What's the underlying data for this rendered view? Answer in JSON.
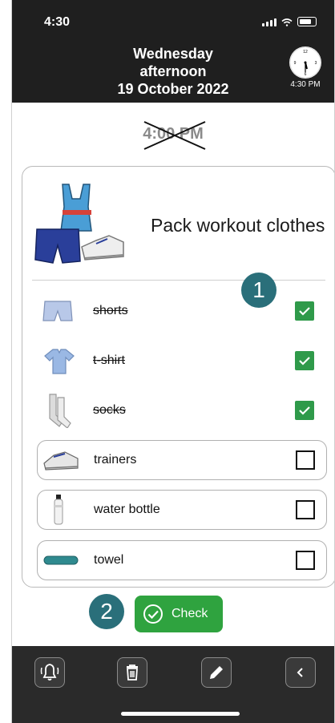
{
  "status": {
    "time": "4:30"
  },
  "header": {
    "line1": "Wednesday",
    "line2": "afternoon",
    "line3": "19 October 2022",
    "clock_label": "4:30 PM"
  },
  "schedule": {
    "time": "4:00 PM"
  },
  "task": {
    "title": "Pack workout clothes",
    "items": [
      {
        "label": "shorts",
        "checked": true
      },
      {
        "label": "t-shirt",
        "checked": true
      },
      {
        "label": "socks",
        "checked": true
      },
      {
        "label": "trainers",
        "checked": false
      },
      {
        "label": "water bottle",
        "checked": false
      },
      {
        "label": "towel",
        "checked": false
      }
    ]
  },
  "badges": {
    "one": "1",
    "two": "2"
  },
  "actions": {
    "check_label": "Check"
  },
  "colors": {
    "header_bg": "#1f1f1f",
    "check_green": "#2f9a4a",
    "button_green": "#2fa33f",
    "badge_teal": "#2a6f7a"
  },
  "toolbar": {
    "icons": [
      "bell-icon",
      "trash-icon",
      "pencil-icon",
      "chevron-left-icon"
    ]
  }
}
